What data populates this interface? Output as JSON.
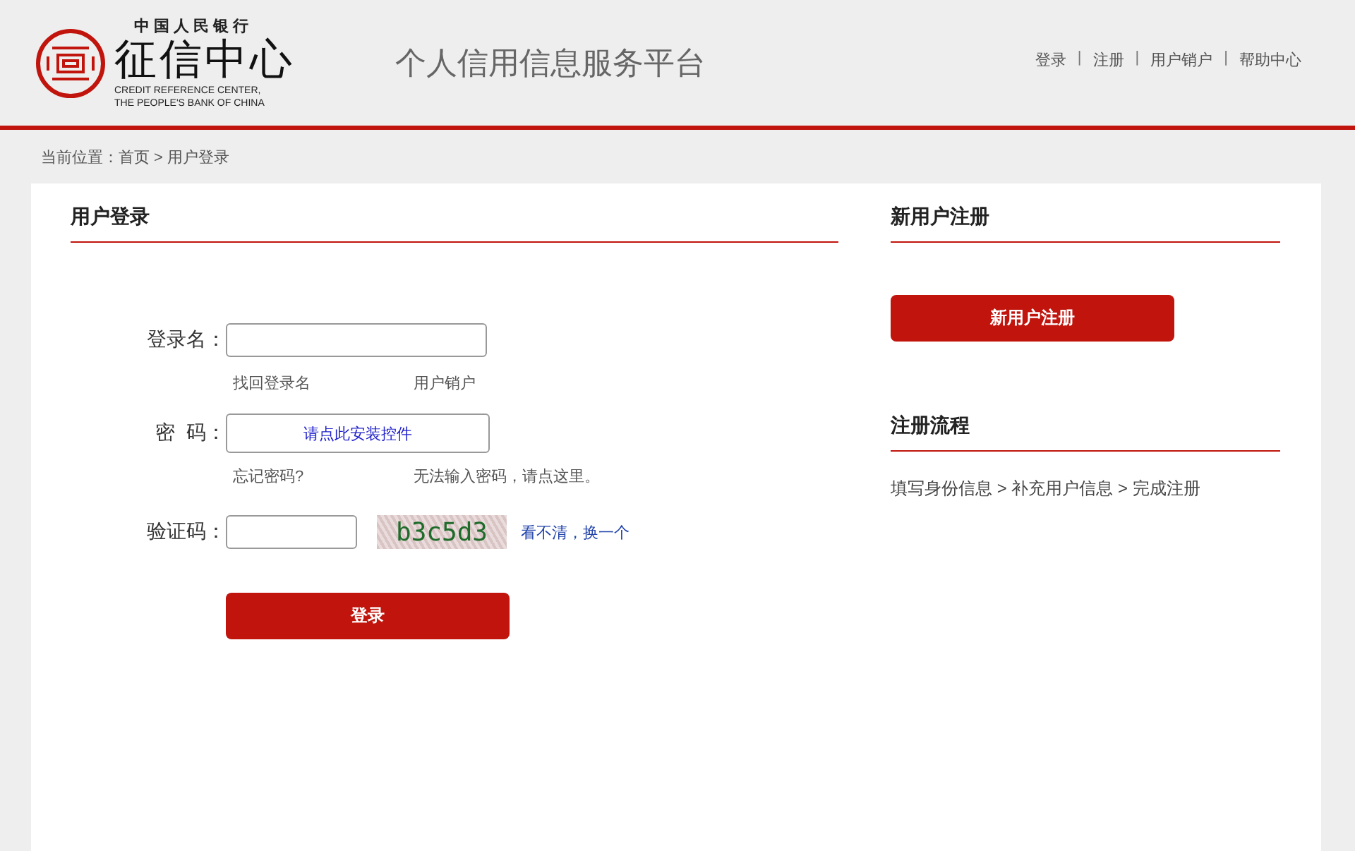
{
  "header": {
    "logo": {
      "top_line": "中国人民银行",
      "name": "征信中心",
      "english_1": "CREDIT REFERENCE CENTER,",
      "english_2": "THE PEOPLE'S BANK OF CHINA"
    },
    "site_title": "个人信用信息服务平台",
    "nav": [
      {
        "kind": "link",
        "label": "登录"
      },
      {
        "kind": "separator",
        "label": "|"
      },
      {
        "kind": "link",
        "label": "注册"
      },
      {
        "kind": "separator",
        "label": "|"
      },
      {
        "kind": "link",
        "label": "用户销户"
      },
      {
        "kind": "separator",
        "label": "|"
      },
      {
        "kind": "link",
        "label": "帮助中心"
      }
    ]
  },
  "breadcrumb": "当前位置：首页 > 用户登录",
  "login": {
    "title": "用户登录",
    "username": {
      "label": "登录名：",
      "links": [
        "找回登录名",
        "用户销户"
      ]
    },
    "password": {
      "label": "密  码：",
      "control_link": "请点此安装控件",
      "links": [
        "忘记密码?",
        "无法输入密码，请点这里。"
      ]
    },
    "captcha": {
      "label": "验证码：",
      "code": "b3c5d3",
      "refresh": "看不清，换一个"
    },
    "submit": "登录"
  },
  "register": {
    "title": "新用户注册",
    "button": "新用户注册",
    "process_title": "注册流程",
    "process": "填写身份信息 > 补充用户信息 > 完成注册"
  }
}
